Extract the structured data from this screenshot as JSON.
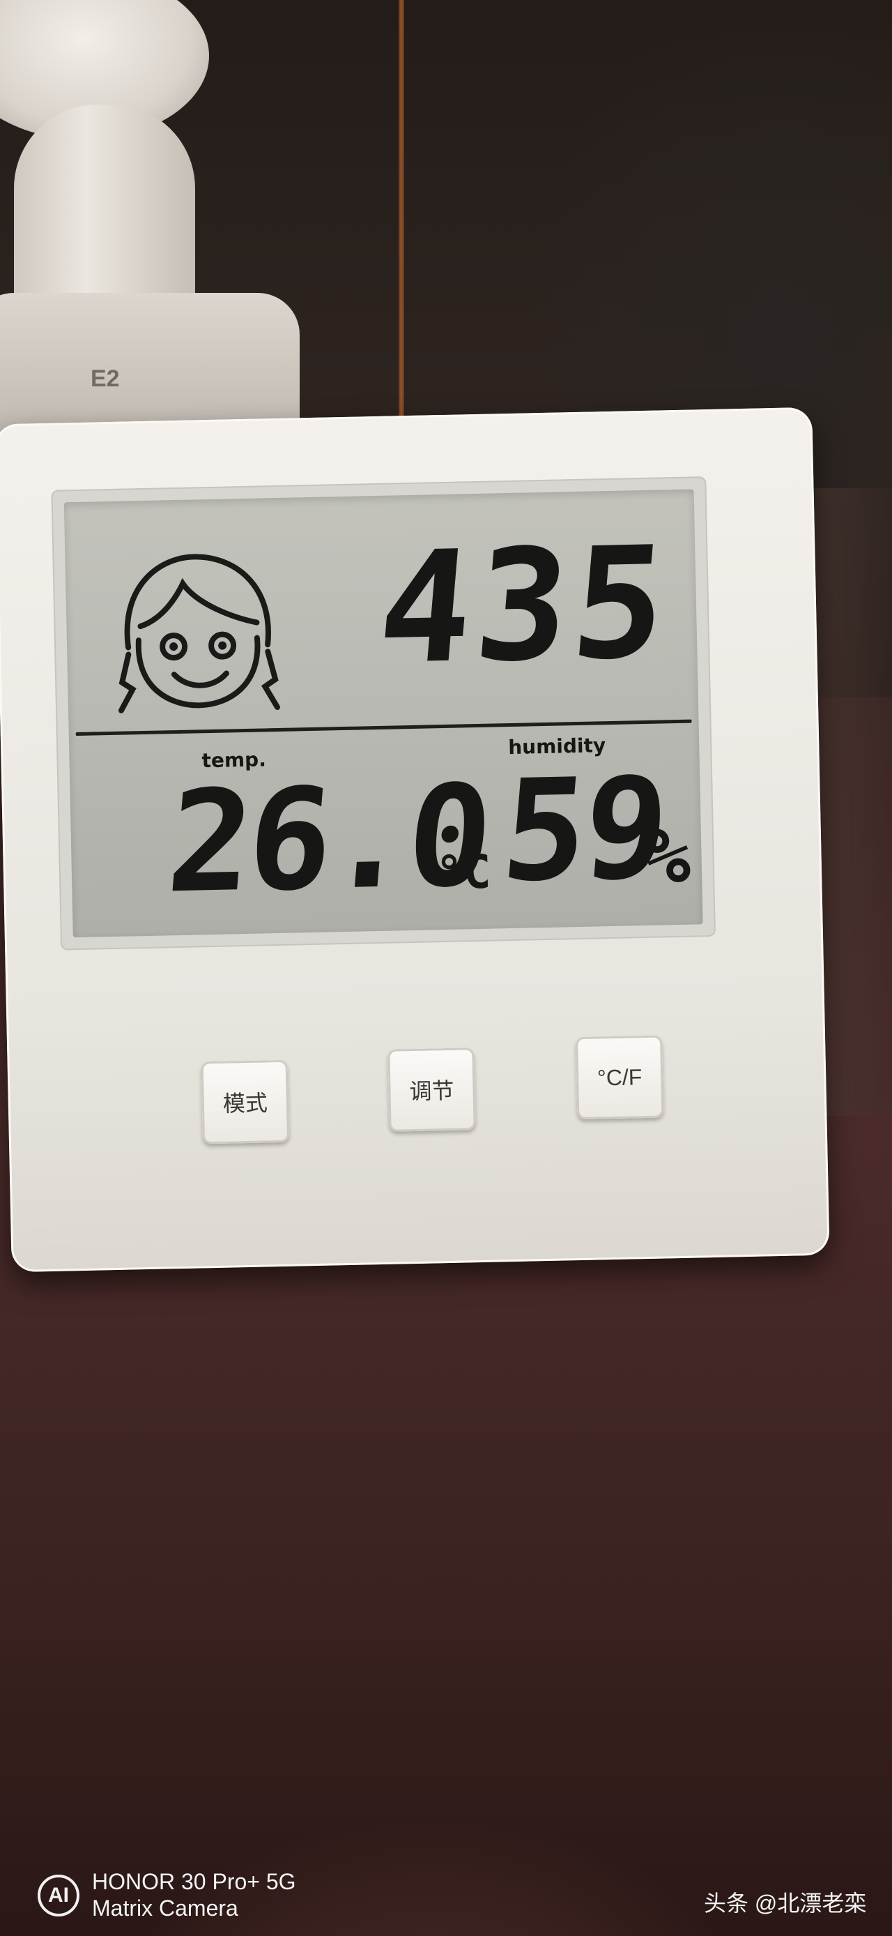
{
  "display": {
    "counter": "435",
    "temp_label": "temp.",
    "humidity_label": "humidity",
    "temperature": "26.0",
    "temperature_unit": "°C",
    "humidity": "59",
    "humidity_unit": "%"
  },
  "buttons": {
    "mode": "模式",
    "adjust": "调节",
    "unit": "°C/F"
  },
  "fan_logo": "E2",
  "camera_watermark": {
    "badge": "AI",
    "model": "HONOR 30 Pro+ 5G",
    "camera": "Matrix Camera"
  },
  "source_tag": "头条 @北漂老栾",
  "colors": {
    "lcd": "#b8b9b2",
    "device_body": "#f1eee9",
    "table": "#4a2b29"
  }
}
